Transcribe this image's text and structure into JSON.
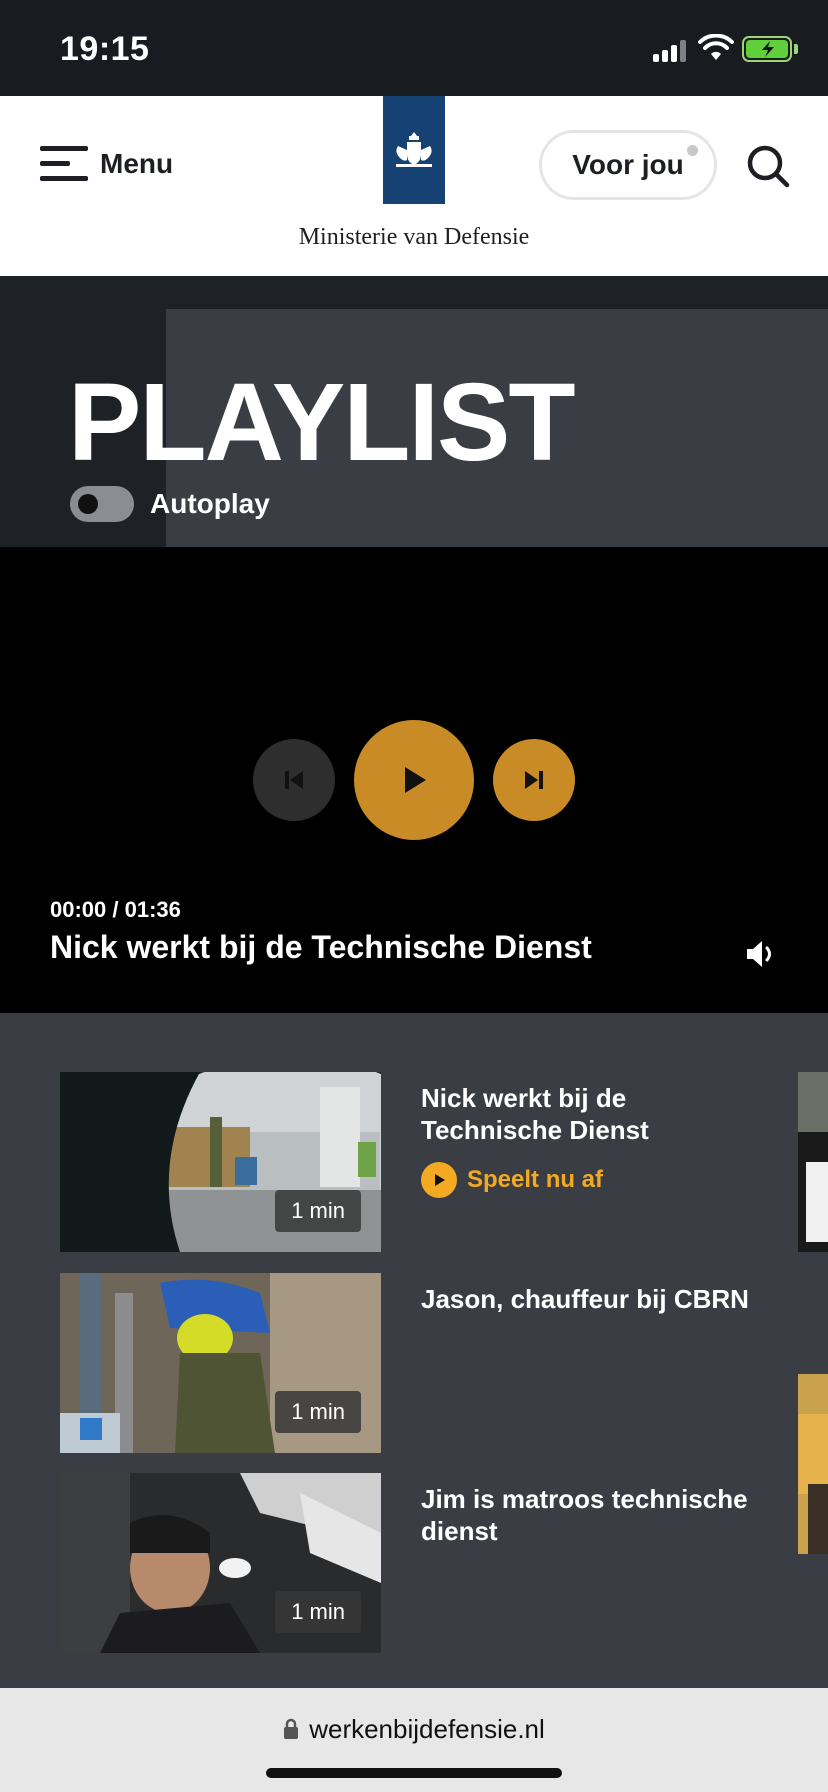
{
  "status_bar": {
    "time": "19:15"
  },
  "header": {
    "menu_label": "Menu",
    "org_name": "Ministerie van Defensie",
    "voor_jou_label": "Voor jou"
  },
  "hero": {
    "title": "PLAYLIST",
    "autoplay_label": "Autoplay",
    "autoplay_on": false
  },
  "player": {
    "time": "00:00 / 01:36",
    "title": "Nick werkt bij de Technische Dienst"
  },
  "playlist": {
    "items": [
      {
        "title": "Nick werkt bij de Technische Dienst",
        "duration": "1 min",
        "now_playing_label": "Speelt nu af"
      },
      {
        "title": "Jason, chauffeur bij CBRN",
        "duration": "1 min"
      },
      {
        "title": "Jim is matroos technische dienst",
        "duration": "1 min"
      }
    ]
  },
  "url_bar": {
    "domain": "werkenbijdefensie.nl"
  },
  "colors": {
    "accent": "#c98b26",
    "now_playing": "#f3a922",
    "header_bg": "#ffffff",
    "logo_blue": "#154273",
    "page_bg": "#3a3d43"
  }
}
